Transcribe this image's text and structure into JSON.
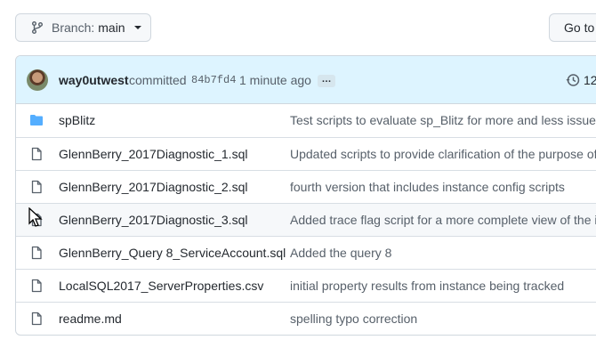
{
  "branch": {
    "prefix": "Branch:",
    "name": "main"
  },
  "goto_label": "Go to",
  "commit": {
    "author": "way0utwest",
    "action": "committed",
    "sha": "84b7fd4",
    "time": "1 minute ago",
    "ellipsis": "…",
    "history_count": "12"
  },
  "files": [
    {
      "type": "folder",
      "icon": "folder-icon",
      "name": "spBlitz",
      "message": "Test scripts to evaluate sp_Blitz for more and less issues"
    },
    {
      "type": "file",
      "icon": "file-icon",
      "name": "GlennBerry_2017Diagnostic_1.sql",
      "message": "Updated scripts to provide clarification of the purpose of"
    },
    {
      "type": "file",
      "icon": "file-icon",
      "name": "GlennBerry_2017Diagnostic_2.sql",
      "message": "fourth version that includes instance config scripts"
    },
    {
      "type": "file",
      "icon": "file-icon",
      "name": "GlennBerry_2017Diagnostic_3.sql",
      "message": "Added trace flag script for a more complete view of the i"
    },
    {
      "type": "file",
      "icon": "file-icon",
      "name": "GlennBerry_Query 8_ServiceAccount.sql",
      "message": "Added the query 8"
    },
    {
      "type": "file",
      "icon": "file-icon",
      "name": "LocalSQL2017_ServerProperties.csv",
      "message": "initial property results from instance being tracked"
    },
    {
      "type": "file",
      "icon": "file-icon",
      "name": "readme.md",
      "message": "spelling typo correction"
    }
  ],
  "colors": {
    "folder": "#54aeff",
    "accent": "#0969da",
    "commit_bg": "#ddf4ff"
  }
}
